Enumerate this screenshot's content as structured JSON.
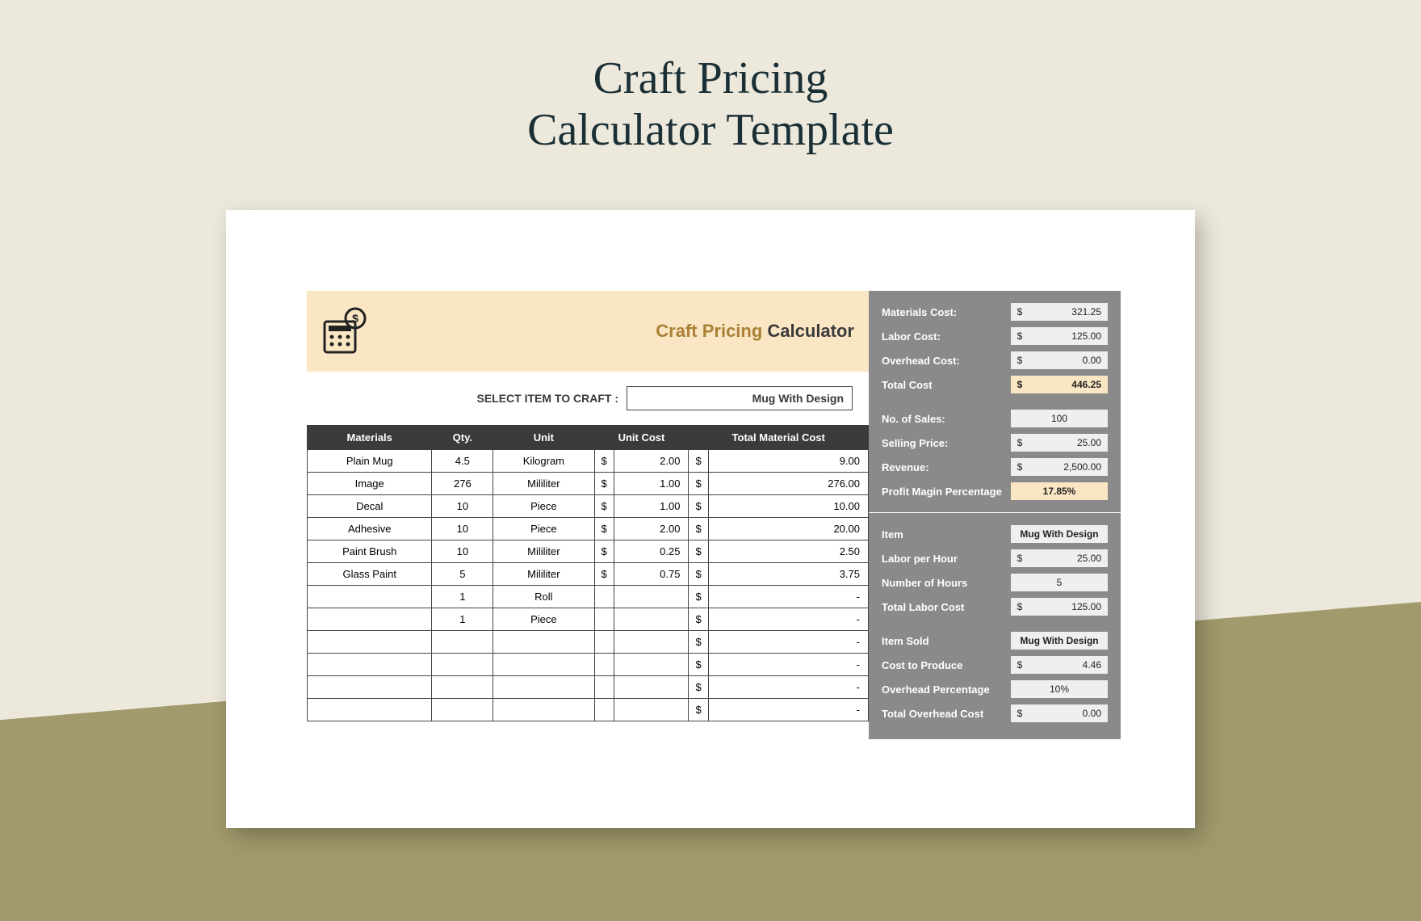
{
  "title_line1": "Craft Pricing",
  "title_line2": "Calculator Template",
  "banner": {
    "word1": "Craft Pricing",
    "word2": " Calculator"
  },
  "select_label": "SELECT ITEM TO CRAFT    :",
  "select_value": "Mug With Design",
  "headers": {
    "materials": "Materials",
    "qty": "Qty.",
    "unit": "Unit",
    "unit_cost": "Unit Cost",
    "total": "Total Material Cost"
  },
  "rows": [
    {
      "material": "Plain Mug",
      "qty": "4.5",
      "unit": "Kilogram",
      "uc_cur": "$",
      "uc": "2.00",
      "t_cur": "$",
      "t": "9.00"
    },
    {
      "material": "Image",
      "qty": "276",
      "unit": "Mililiter",
      "uc_cur": "$",
      "uc": "1.00",
      "t_cur": "$",
      "t": "276.00"
    },
    {
      "material": "Decal",
      "qty": "10",
      "unit": "Piece",
      "uc_cur": "$",
      "uc": "1.00",
      "t_cur": "$",
      "t": "10.00"
    },
    {
      "material": "Adhesive",
      "qty": "10",
      "unit": "Piece",
      "uc_cur": "$",
      "uc": "2.00",
      "t_cur": "$",
      "t": "20.00"
    },
    {
      "material": "Paint Brush",
      "qty": "10",
      "unit": "Mililiter",
      "uc_cur": "$",
      "uc": "0.25",
      "t_cur": "$",
      "t": "2.50"
    },
    {
      "material": "Glass Paint",
      "qty": "5",
      "unit": "Mililiter",
      "uc_cur": "$",
      "uc": "0.75",
      "t_cur": "$",
      "t": "3.75"
    },
    {
      "material": "",
      "qty": "1",
      "unit": "Roll",
      "uc_cur": "",
      "uc": "",
      "t_cur": "$",
      "t": "-"
    },
    {
      "material": "",
      "qty": "1",
      "unit": "Piece",
      "uc_cur": "",
      "uc": "",
      "t_cur": "$",
      "t": "-"
    },
    {
      "material": "",
      "qty": "",
      "unit": "",
      "uc_cur": "",
      "uc": "",
      "t_cur": "$",
      "t": "-"
    },
    {
      "material": "",
      "qty": "",
      "unit": "",
      "uc_cur": "",
      "uc": "",
      "t_cur": "$",
      "t": "-"
    },
    {
      "material": "",
      "qty": "",
      "unit": "",
      "uc_cur": "",
      "uc": "",
      "t_cur": "$",
      "t": "-"
    },
    {
      "material": "",
      "qty": "",
      "unit": "",
      "uc_cur": "",
      "uc": "",
      "t_cur": "$",
      "t": "-"
    }
  ],
  "summary": {
    "materials_cost_l": "Materials Cost:",
    "materials_cost_c": "$",
    "materials_cost_v": "321.25",
    "labor_cost_l": "Labor Cost:",
    "labor_cost_c": "$",
    "labor_cost_v": "125.00",
    "overhead_cost_l": "Overhead Cost:",
    "overhead_cost_c": "$",
    "overhead_cost_v": "0.00",
    "total_cost_l": "Total Cost",
    "total_cost_c": "$",
    "total_cost_v": "446.25",
    "sales_l": "No. of Sales:",
    "sales_v": "100",
    "selling_l": "Selling Price:",
    "selling_c": "$",
    "selling_v": "25.00",
    "revenue_l": "Revenue:",
    "revenue_c": "$",
    "revenue_v": "2,500.00",
    "margin_l": "Profit Magin Percentage",
    "margin_v": "17.85%",
    "item_l": "Item",
    "item_v": "Mug With Design",
    "lph_l": "Labor per Hour",
    "lph_c": "$",
    "lph_v": "25.00",
    "hours_l": "Number of Hours",
    "hours_v": "5",
    "tlc_l": "Total Labor Cost",
    "tlc_c": "$",
    "tlc_v": "125.00",
    "sold_l": "Item Sold",
    "sold_v": "Mug With Design",
    "ctp_l": "Cost to Produce",
    "ctp_c": "$",
    "ctp_v": "4.46",
    "op_l": "Overhead Percentage",
    "op_v": "10%",
    "toc_l": "Total Overhead Cost",
    "toc_c": "$",
    "toc_v": "0.00"
  }
}
